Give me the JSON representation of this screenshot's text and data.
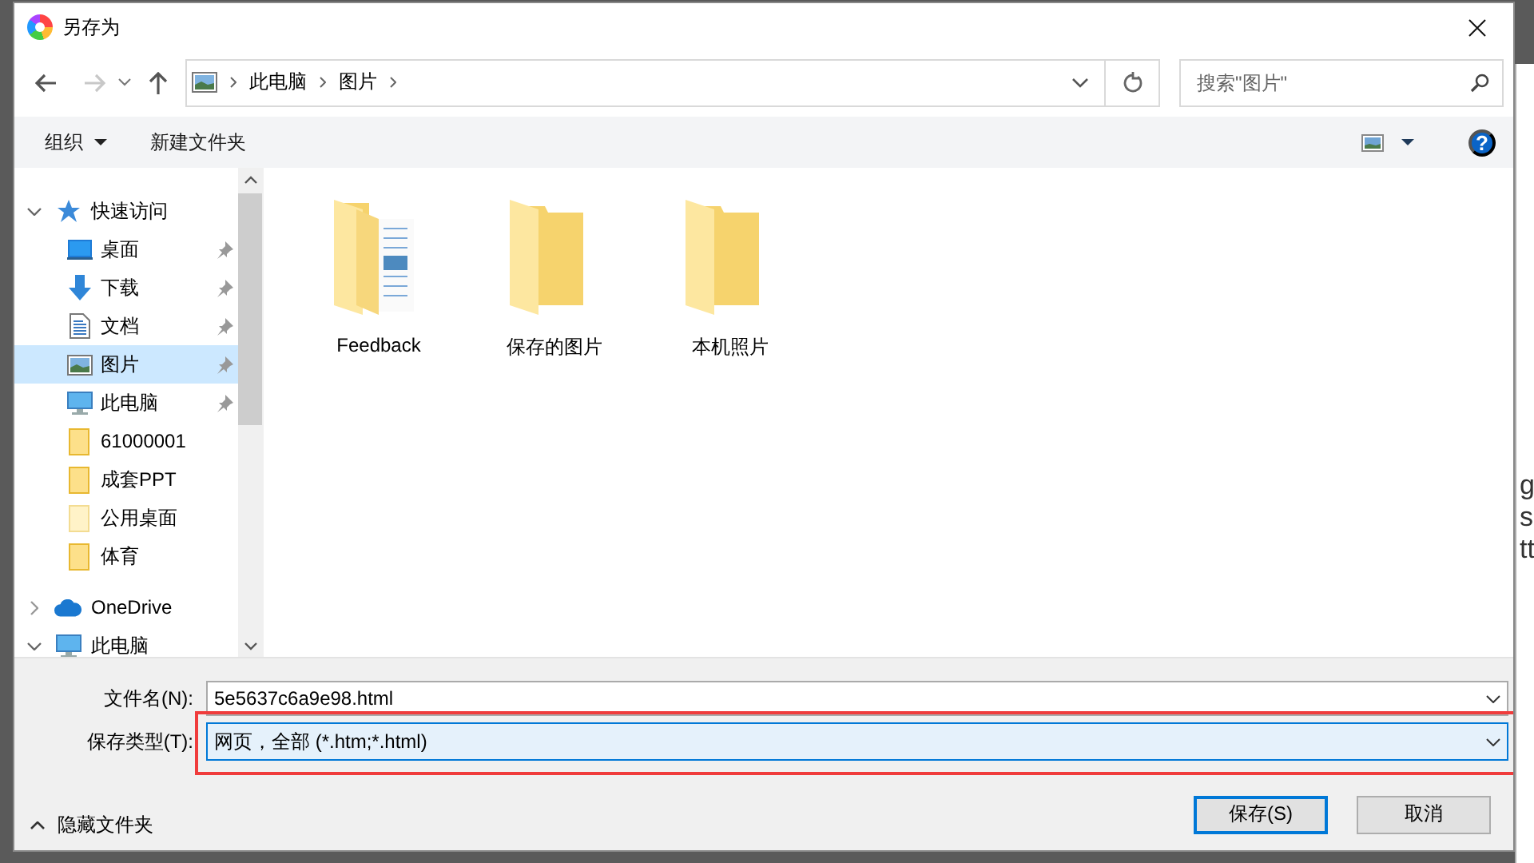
{
  "window": {
    "title": "另存为"
  },
  "navigation": {
    "back": {
      "disabled": false
    },
    "forward": {
      "disabled": true
    },
    "up": {
      "disabled": false
    }
  },
  "address_bar": {
    "breadcrumbs": [
      "此电脑",
      "图片"
    ]
  },
  "search": {
    "placeholder": "搜索\"图片\""
  },
  "toolbar": {
    "organize": "组织",
    "new_folder": "新建文件夹",
    "help": "?"
  },
  "sidebar": {
    "items": [
      {
        "label": "快速访问",
        "kind": "star",
        "expanded": true,
        "selected": false,
        "children": [
          {
            "label": "桌面",
            "kind": "desktop",
            "pinned": true,
            "selected": false
          },
          {
            "label": "下载",
            "kind": "download",
            "pinned": true,
            "selected": false
          },
          {
            "label": "文档",
            "kind": "document",
            "pinned": true,
            "selected": false
          },
          {
            "label": "图片",
            "kind": "pictures",
            "pinned": true,
            "selected": true
          },
          {
            "label": "此电脑",
            "kind": "pc",
            "pinned": true,
            "selected": false
          },
          {
            "label": "61000001",
            "kind": "folder",
            "pinned": false,
            "selected": false
          },
          {
            "label": "成套PPT",
            "kind": "folder",
            "pinned": false,
            "selected": false
          },
          {
            "label": "公用桌面",
            "kind": "folder-light",
            "pinned": false,
            "selected": false
          },
          {
            "label": "体育",
            "kind": "folder",
            "pinned": false,
            "selected": false
          }
        ]
      },
      {
        "label": "OneDrive",
        "kind": "cloud",
        "expanded": false,
        "selected": false
      },
      {
        "label": "此电脑",
        "kind": "pc",
        "expanded": true,
        "selected": false
      }
    ]
  },
  "files": [
    {
      "name": "Feedback",
      "kind": "folder-documents",
      "selected": false
    },
    {
      "name": "保存的图片",
      "kind": "folder",
      "selected": false
    },
    {
      "name": "本机照片",
      "kind": "folder",
      "selected": false
    }
  ],
  "filename": {
    "label": "文件名(N):",
    "value": "5e5637c6a9e98.html"
  },
  "file_type": {
    "label": "保存类型(T):",
    "value": "网页，全部 (*.htm;*.html)",
    "highlighted": true
  },
  "hide_folders": {
    "label": "隐藏文件夹"
  },
  "buttons": [
    {
      "label": "保存(S)",
      "kind": "primary"
    },
    {
      "label": "取消",
      "kind": "secondary"
    }
  ],
  "background_page": {
    "lines": [
      "g",
      "s",
      "tt"
    ]
  }
}
